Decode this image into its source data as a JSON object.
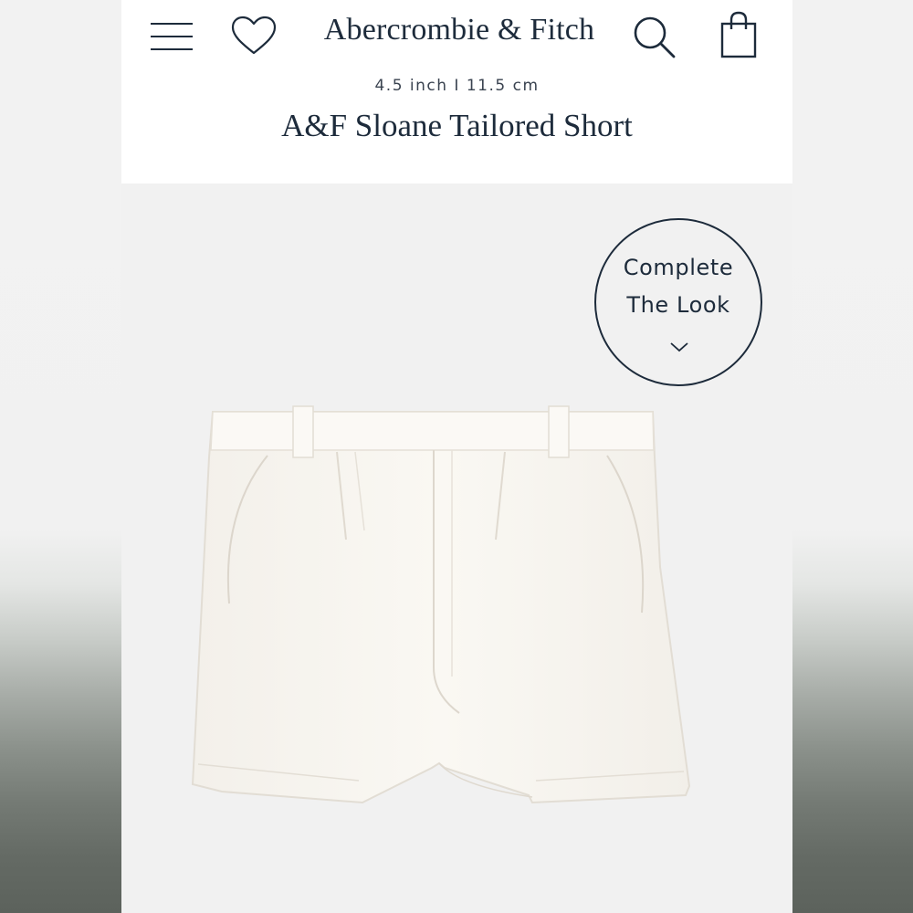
{
  "header": {
    "brand": "Abercrombie & Fitch",
    "icons": {
      "menu": "menu-icon",
      "wishlist": "heart-icon",
      "search": "search-icon",
      "bag": "shopping-bag-icon"
    }
  },
  "product": {
    "length": "4.5 inch I 11.5 cm",
    "title": "A&F Sloane Tailored Short"
  },
  "complete_the_look": {
    "line1": "Complete",
    "line2": "The Look",
    "icon": "chevron-down-icon"
  },
  "colors": {
    "text": "#1d2b3b",
    "image_background": "#f1f1f1",
    "product": "#f7f4ee"
  }
}
